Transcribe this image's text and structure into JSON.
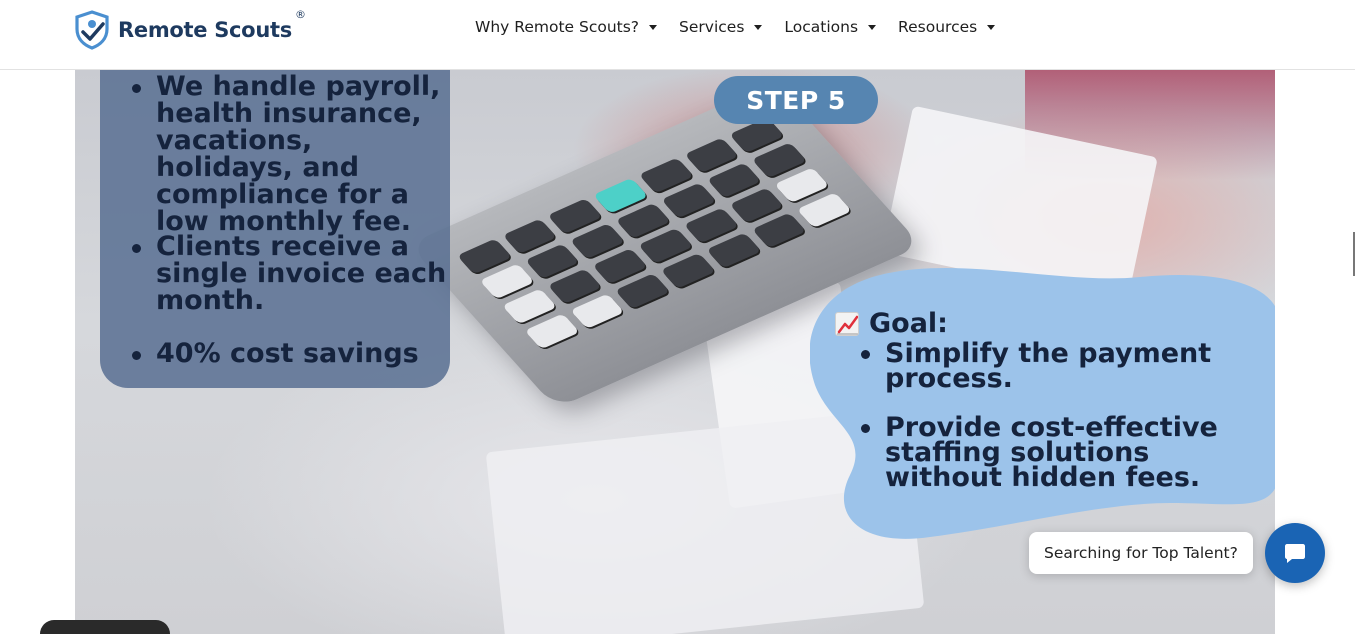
{
  "header": {
    "brand_name": "Remote Scouts",
    "brand_mark": "®",
    "logo_icon": "shield-check-icon",
    "nav_items": [
      {
        "label": "Why Remote Scouts?"
      },
      {
        "label": "Services"
      },
      {
        "label": "Locations"
      },
      {
        "label": "Resources"
      }
    ]
  },
  "hero": {
    "step_label": "STEP 5",
    "left_panel": {
      "bullets": [
        "We handle payroll, health insurance, vacations, holidays, and compliance for a low monthly fee.",
        "Clients receive a single invoice each month.",
        "40% cost savings"
      ]
    },
    "goal": {
      "icon": "chart-increasing-emoji",
      "title": "Goal:",
      "items": [
        "Simplify the payment process.",
        "Provide cost-effective staffing solutions without hidden fees."
      ]
    }
  },
  "chat": {
    "prompt": "Searching for Top Talent?",
    "button_icon": "chat-icon"
  },
  "colors": {
    "brand_navy": "#1e3a5f",
    "step_pill": "#5685b1",
    "left_panel": "#586e92",
    "goal_blob": "#9cc3ea",
    "chat_button": "#1a64b4"
  }
}
